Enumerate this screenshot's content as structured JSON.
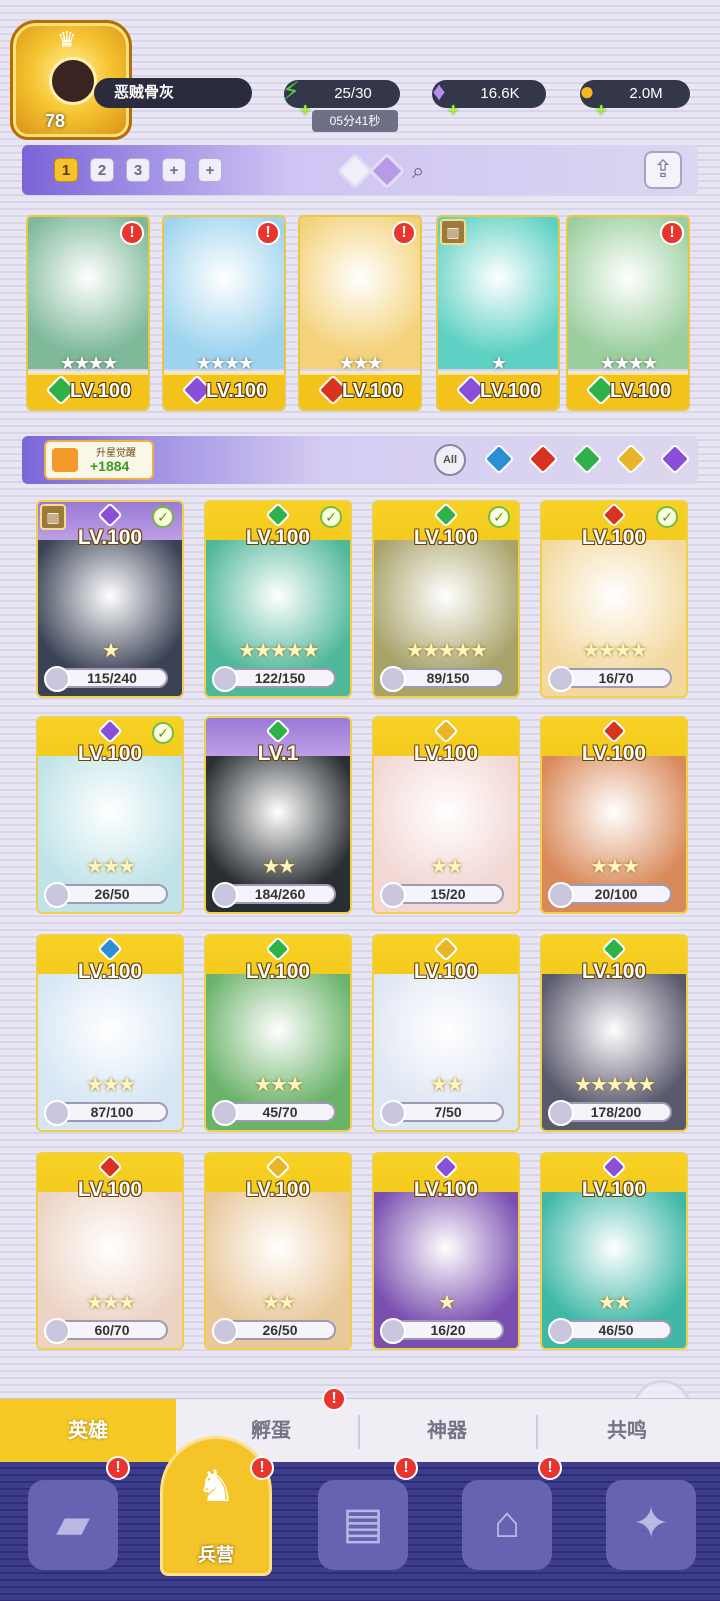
{
  "player": {
    "level": "78",
    "name": "恶贼骨灰"
  },
  "resources": [
    {
      "icon": "lightning-icon",
      "value": "25/30",
      "color": "#4fd13a"
    },
    {
      "icon": "diamond-icon",
      "value": "16.6K",
      "color": "#b98cf2"
    },
    {
      "icon": "gold-coin-icon",
      "value": "2.0M",
      "color": "#f5b81f"
    }
  ],
  "energy_timer": "05分41秒",
  "team_tabs": [
    "1",
    "2",
    "3",
    "+",
    "+"
  ],
  "team": [
    {
      "level": "LV.100",
      "stars": "★★★★",
      "element": "#2fb14a",
      "art": "#7fb99a",
      "badge": "!"
    },
    {
      "level": "LV.100",
      "stars": "★★★★",
      "element": "#8a4fd6",
      "art": "#9fd4ee",
      "badge": "!"
    },
    {
      "level": "LV.100",
      "stars": "★★★",
      "element": "#d8331f",
      "art": "#f4d27a",
      "badge": "!"
    },
    {
      "level": "LV.100",
      "stars": "★",
      "element": "#8a4fd6",
      "art": "#5fd1c4",
      "badge": "lock"
    },
    {
      "level": "LV.100",
      "stars": "★★★★",
      "element": "#2fb14a",
      "art": "#9ccf9f",
      "badge": "!"
    }
  ],
  "star_up": {
    "title": "升星觉醒",
    "count": "+1884"
  },
  "filters": {
    "all_label": "All",
    "gems": [
      "#2a8fd4",
      "#d8331f",
      "#2fb14a",
      "#e8b42a",
      "#8a4fd6"
    ]
  },
  "heroes": [
    {
      "level": "LV.100",
      "shards": "115/240",
      "stars": "★",
      "element": "#8a4fd6",
      "art": "#3b4256",
      "check": true,
      "lock": true,
      "purple": true
    },
    {
      "level": "LV.100",
      "shards": "122/150",
      "stars": "★★★★★",
      "element": "#2fb14a",
      "art": "#4fb79a",
      "check": true
    },
    {
      "level": "LV.100",
      "shards": "89/150",
      "stars": "★★★★★",
      "element": "#2fb14a",
      "art": "#a9a36a",
      "check": true
    },
    {
      "level": "LV.100",
      "shards": "16/70",
      "stars": "★★★★",
      "element": "#d8331f",
      "art": "#f3d9a0",
      "check": true
    },
    {
      "level": "LV.100",
      "shards": "26/50",
      "stars": "★★★",
      "element": "#8a4fd6",
      "art": "#bfe3e8",
      "check": true
    },
    {
      "level": "LV.1",
      "shards": "184/260",
      "stars": "★★",
      "element": "#2fb14a",
      "art": "#2a2f33",
      "purple": true
    },
    {
      "level": "LV.100",
      "shards": "15/20",
      "stars": "★★",
      "element": "#e8b42a",
      "art": "#f2d7d4"
    },
    {
      "level": "LV.100",
      "shards": "20/100",
      "stars": "★★★",
      "element": "#d8331f",
      "art": "#d98a5a"
    },
    {
      "level": "LV.100",
      "shards": "87/100",
      "stars": "★★★",
      "element": "#2a8fd4",
      "art": "#d6e6f4"
    },
    {
      "level": "LV.100",
      "shards": "45/70",
      "stars": "★★★",
      "element": "#2fb14a",
      "art": "#6bb36a"
    },
    {
      "level": "LV.100",
      "shards": "7/50",
      "stars": "★★",
      "element": "#e8b42a",
      "art": "#dfe6f3"
    },
    {
      "level": "LV.100",
      "shards": "178/200",
      "stars": "★★★★★",
      "element": "#2fb14a",
      "art": "#5a5a6e"
    },
    {
      "level": "LV.100",
      "shards": "60/70",
      "stars": "★★★",
      "element": "#d8331f",
      "art": "#ecd3c4"
    },
    {
      "level": "LV.100",
      "shards": "26/50",
      "stars": "★★",
      "element": "#e8b42a",
      "art": "#e9c89a"
    },
    {
      "level": "LV.100",
      "shards": "16/20",
      "stars": "★",
      "element": "#8a4fd6",
      "art": "#7a4fb0"
    },
    {
      "level": "LV.100",
      "shards": "46/50",
      "stars": "★★",
      "element": "#8a4fd6",
      "art": "#3fb8a8"
    }
  ],
  "sub_tabs": [
    {
      "label": "英雄",
      "active": true
    },
    {
      "label": "孵蛋",
      "badge": "!"
    },
    {
      "label": "神器"
    },
    {
      "label": "共鸣"
    }
  ],
  "nav": [
    {
      "icon": "cards-icon",
      "glyph": "▰",
      "badge": "!"
    },
    {
      "icon": "barracks-icon",
      "glyph": "♞",
      "label": "兵营",
      "active": true,
      "badge": "!"
    },
    {
      "icon": "book-icon",
      "glyph": "▤",
      "badge": "!"
    },
    {
      "icon": "shop-icon",
      "glyph": "⌂",
      "badge": "!"
    },
    {
      "icon": "guild-icon",
      "glyph": "✦"
    }
  ]
}
